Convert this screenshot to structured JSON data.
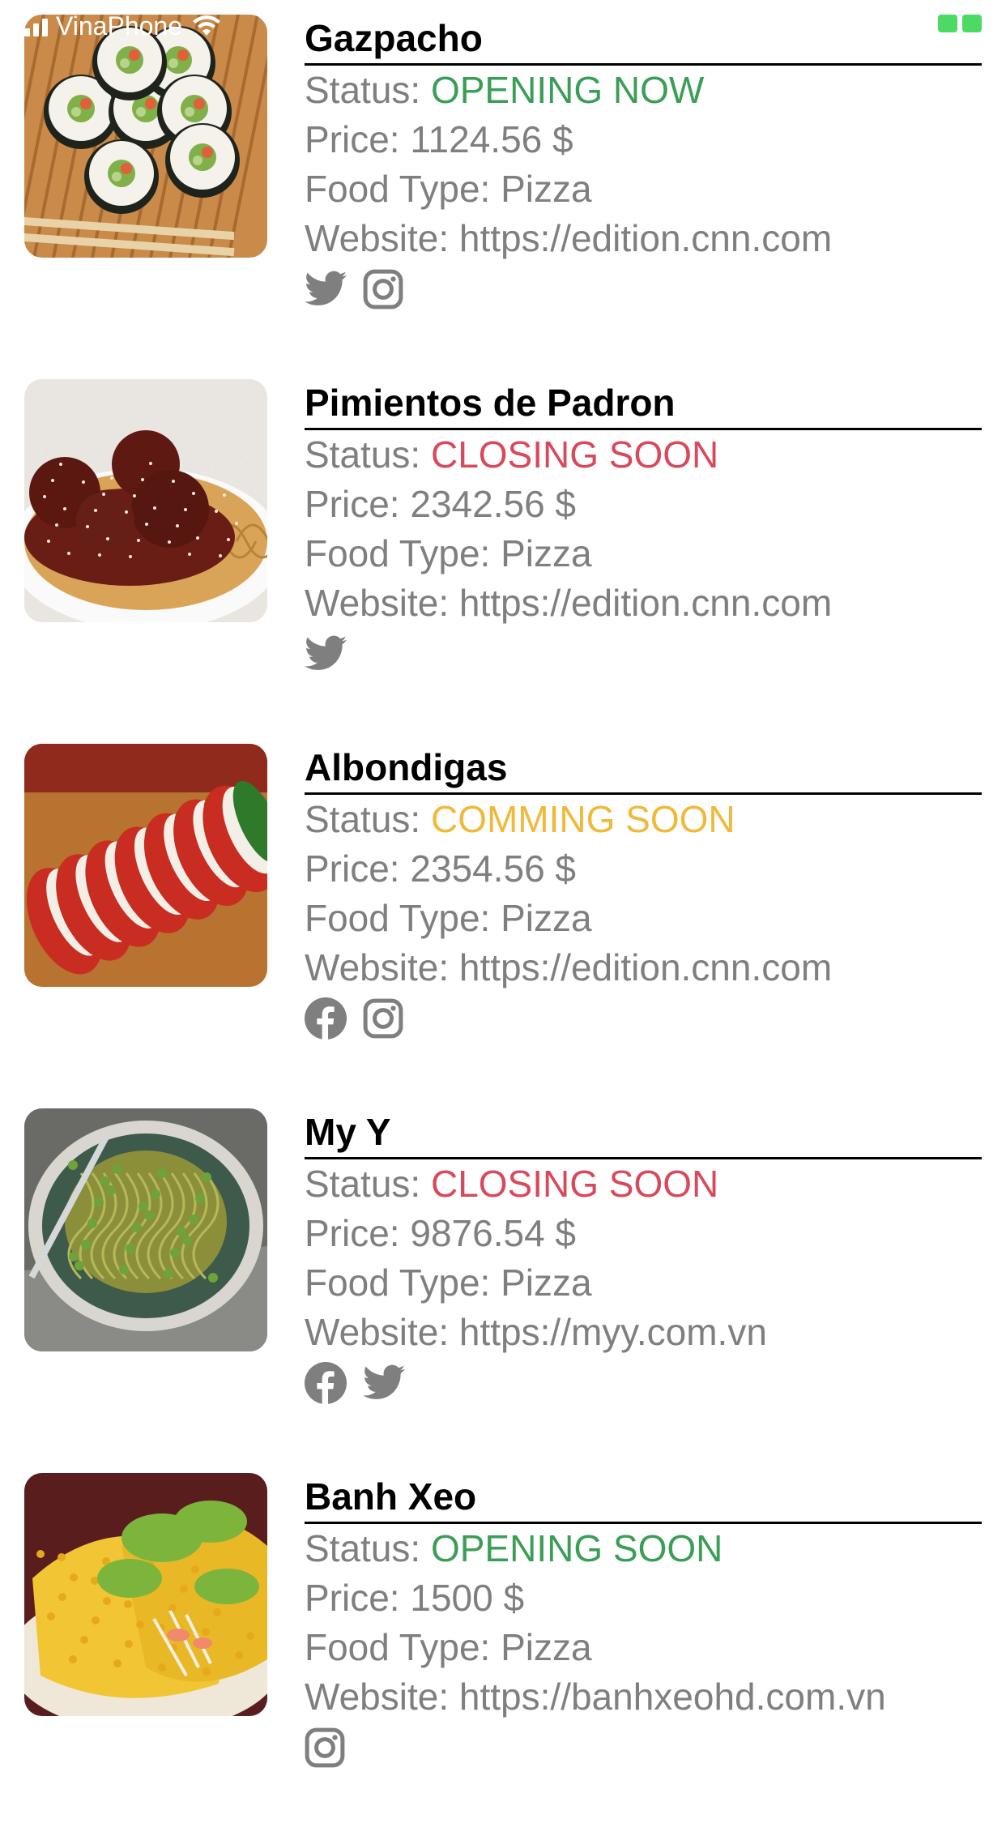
{
  "status_bar": {
    "carrier": "VinaPhone"
  },
  "labels": {
    "status": "Status: ",
    "price": "Price: ",
    "food_type": "Food Type: ",
    "website": "Website: "
  },
  "colors": {
    "opening": "#3b9e56",
    "closing": "#d9495c",
    "coming": "#f0b93a",
    "text_gray": "#7f7f7f"
  },
  "items": [
    {
      "name": "Gazpacho",
      "status": "OPENING NOW",
      "status_color": "green",
      "price": "1124.56 $",
      "food_type": "Pizza",
      "website": "https://edition.cnn.com",
      "socials": [
        "twitter-icon",
        "instagram-icon"
      ],
      "image": "sushi"
    },
    {
      "name": "Pimientos de Padron",
      "status": "CLOSING SOON",
      "status_color": "red",
      "price": "2342.56 $",
      "food_type": "Pizza",
      "website": "https://edition.cnn.com",
      "socials": [
        "twitter-icon"
      ],
      "image": "meatballs"
    },
    {
      "name": "Albondigas",
      "status": "COMMING SOON",
      "status_color": "amber",
      "price": "2354.56 $",
      "food_type": "Pizza",
      "website": "https://edition.cnn.com",
      "socials": [
        "facebook-icon",
        "instagram-icon"
      ],
      "image": "caprese"
    },
    {
      "name": "My Y",
      "status": "CLOSING SOON",
      "status_color": "red",
      "price": "9876.54 $",
      "food_type": "Pizza",
      "website": "https://myy.com.vn",
      "socials": [
        "facebook-icon",
        "twitter-icon"
      ],
      "image": "pesto"
    },
    {
      "name": "Banh Xeo",
      "status": "OPENING SOON",
      "status_color": "green",
      "price": "1500 $",
      "food_type": "Pizza",
      "website": "https://banhxeohd.com.vn",
      "socials": [
        "instagram-icon"
      ],
      "image": "banhxeo"
    }
  ]
}
